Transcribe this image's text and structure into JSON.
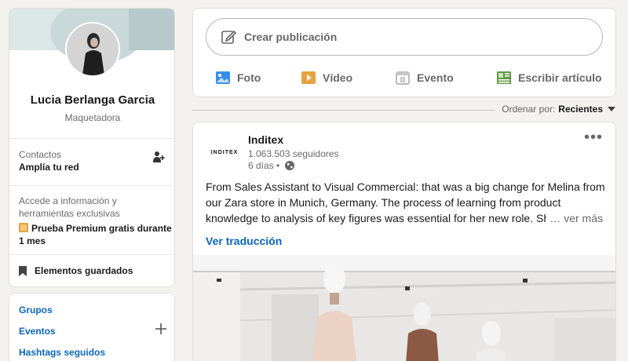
{
  "profile": {
    "name": "Lucia Berlanga Garcia",
    "title": "Maquetadora",
    "contacts_label": "Contactos",
    "contacts_sub": "Amplía tu red",
    "premium_text": "Accede a información y herramientas exclusivas",
    "premium_link": "Prueba Premium gratis durante 1 mes",
    "saved_label": "Elementos guardados"
  },
  "left_links": {
    "groups": "Grupos",
    "events": "Eventos",
    "hashtags": "Hashtags seguidos"
  },
  "share": {
    "placeholder": "Crear publicación",
    "photo": "Foto",
    "video": "Vídeo",
    "event": "Evento",
    "article": "Escribir artículo"
  },
  "sort": {
    "label": "Ordenar por:",
    "value": "Recientes"
  },
  "post": {
    "logo_text": "INDITEX",
    "company": "Inditex",
    "followers": "1.063.503 seguidores",
    "time": "6 días •",
    "text": "From Sales Assistant to Visual Commercial: that was a big change for Melina from our Zara store in Munich, Germany. The process of learning from product knowledge to analysis of key figures was essential for her new role. She k",
    "see_more": "… ver más",
    "translate": "Ver traducción"
  },
  "colors": {
    "background": "#f3f2ef",
    "link": "#0a66c2",
    "photo_icon": "#378fe9",
    "video_icon": "#e7a33e",
    "article_icon": "#5f9b41"
  }
}
